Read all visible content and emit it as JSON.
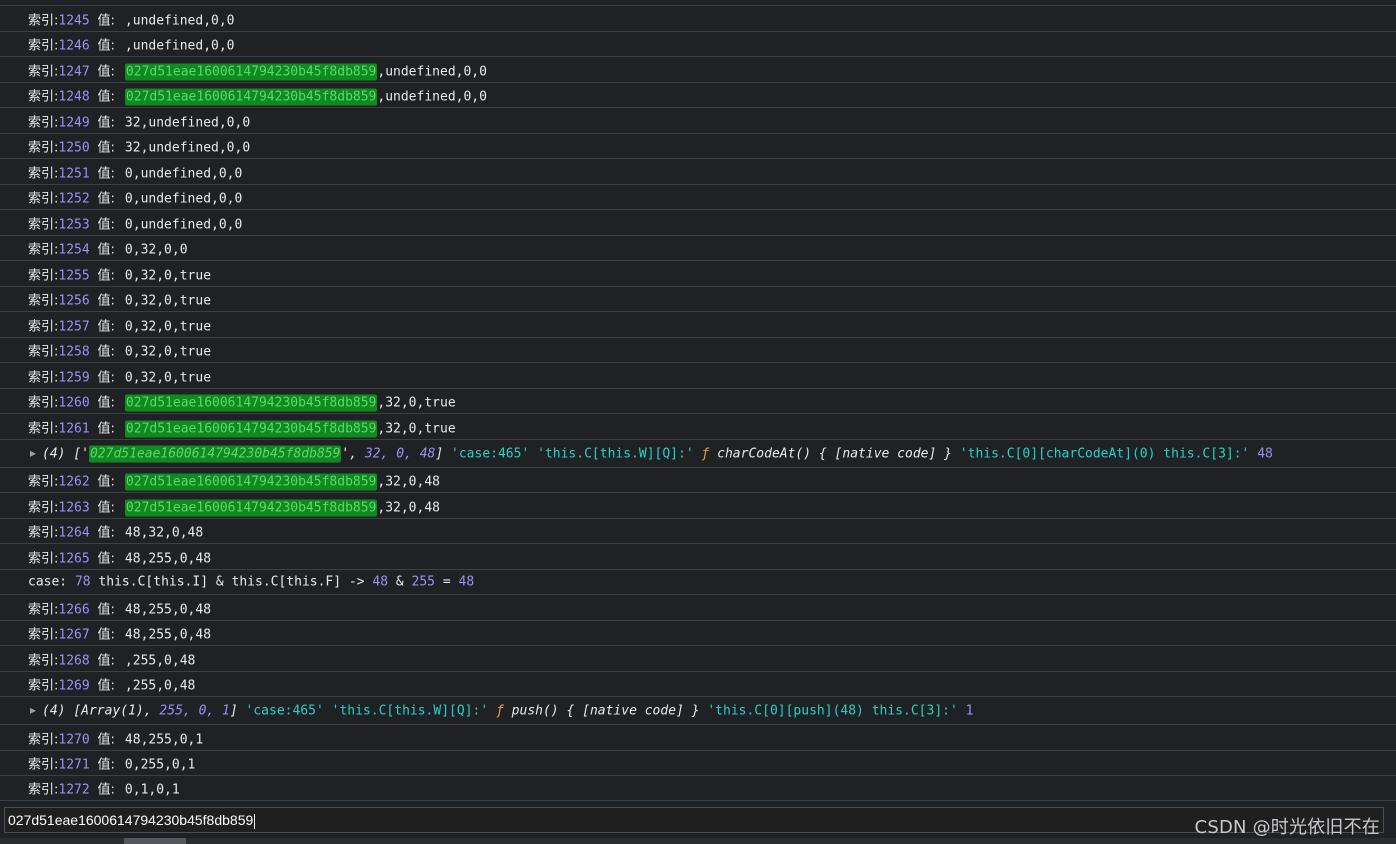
{
  "labels": {
    "index": "索引:",
    "value": "值:",
    "case": "case:"
  },
  "log_rows": [
    {
      "index": "1245",
      "value_pre": ",undefined,0,0",
      "highlight": "",
      "value_post": ""
    },
    {
      "index": "1246",
      "value_pre": ",undefined,0,0",
      "highlight": "",
      "value_post": ""
    },
    {
      "index": "1247",
      "value_pre": "",
      "highlight": "027d51eae1600614794230b45f8db859",
      "value_post": ",undefined,0,0"
    },
    {
      "index": "1248",
      "value_pre": "",
      "highlight": "027d51eae1600614794230b45f8db859",
      "value_post": ",undefined,0,0"
    },
    {
      "index": "1249",
      "value_pre": "32,undefined,0,0",
      "highlight": "",
      "value_post": ""
    },
    {
      "index": "1250",
      "value_pre": "32,undefined,0,0",
      "highlight": "",
      "value_post": ""
    },
    {
      "index": "1251",
      "value_pre": "0,undefined,0,0",
      "highlight": "",
      "value_post": ""
    },
    {
      "index": "1252",
      "value_pre": "0,undefined,0,0",
      "highlight": "",
      "value_post": ""
    },
    {
      "index": "1253",
      "value_pre": "0,undefined,0,0",
      "highlight": "",
      "value_post": ""
    },
    {
      "index": "1254",
      "value_pre": "0,32,0,0",
      "highlight": "",
      "value_post": ""
    },
    {
      "index": "1255",
      "value_pre": "0,32,0,true",
      "highlight": "",
      "value_post": ""
    },
    {
      "index": "1256",
      "value_pre": "0,32,0,true",
      "highlight": "",
      "value_post": ""
    },
    {
      "index": "1257",
      "value_pre": "0,32,0,true",
      "highlight": "",
      "value_post": ""
    },
    {
      "index": "1258",
      "value_pre": "0,32,0,true",
      "highlight": "",
      "value_post": ""
    },
    {
      "index": "1259",
      "value_pre": "0,32,0,true",
      "highlight": "",
      "value_post": ""
    },
    {
      "index": "1260",
      "value_pre": "",
      "highlight": "027d51eae1600614794230b45f8db859",
      "value_post": ",32,0,true"
    },
    {
      "index": "1261",
      "value_pre": "",
      "highlight": "027d51eae1600614794230b45f8db859",
      "value_post": ",32,0,true"
    },
    {
      "index": "1262",
      "value_pre": "",
      "highlight": "027d51eae1600614794230b45f8db859",
      "value_post": ",32,0,48"
    },
    {
      "index": "1263",
      "value_pre": "",
      "highlight": "027d51eae1600614794230b45f8db859",
      "value_post": ",32,0,48"
    },
    {
      "index": "1264",
      "value_pre": "48,32,0,48",
      "highlight": "",
      "value_post": ""
    },
    {
      "index": "1265",
      "value_pre": "48,255,0,48",
      "highlight": "",
      "value_post": ""
    },
    {
      "index": "1266",
      "value_pre": "48,255,0,48",
      "highlight": "",
      "value_post": ""
    },
    {
      "index": "1267",
      "value_pre": "48,255,0,48",
      "highlight": "",
      "value_post": ""
    },
    {
      "index": "1268",
      "value_pre": ",255,0,48",
      "highlight": "",
      "value_post": ""
    },
    {
      "index": "1269",
      "value_pre": ",255,0,48",
      "highlight": "",
      "value_post": ""
    },
    {
      "index": "1270",
      "value_pre": "48,255,0,1",
      "highlight": "",
      "value_post": ""
    },
    {
      "index": "1271",
      "value_pre": "0,255,0,1",
      "highlight": "",
      "value_post": ""
    },
    {
      "index": "1272",
      "value_pre": "0,1,0,1",
      "highlight": "",
      "value_post": ""
    }
  ],
  "array_log_1": {
    "count": "(4)",
    "open": "['",
    "highlight": "027d51eae1600614794230b45f8db859",
    "close_quote": "',",
    "n1": "32,",
    "n2": "0,",
    "n3": "48",
    "close": "]",
    "s1": "'case:465'",
    "s2": "'this.C[this.W][Q]:'",
    "f": "ƒ",
    "fn_text": "charCodeAt() { [native code] }",
    "s3": "'this.C[0][charCodeAt](0) this.C[3]:'",
    "tail": "48"
  },
  "case_log": {
    "num": "78",
    "expr": "this.C[this.I] & this.C[this.F] ->",
    "a": "48",
    "op": "&",
    "b": "255",
    "eq": "=",
    "result": "48"
  },
  "array_log_2": {
    "count": "(4)",
    "open": "[Array(1),",
    "n1": "255,",
    "n2": "0,",
    "n3": "1",
    "close": "]",
    "s1": "'case:465'",
    "s2": "'this.C[this.W][Q]:'",
    "f": "ƒ",
    "fn_text": "push() { [native code] }",
    "s3": "'this.C[0][push](48) this.C[3]:'",
    "tail": "1"
  },
  "console_input": {
    "value": "027d51eae1600614794230b45f8db859"
  },
  "watermark": "CSDN @时光依旧不在",
  "colors": {
    "background": "#202124",
    "index_purple": "#9e8ff5",
    "highlight_green": "#0f8a1f",
    "string_cyan": "#22d3c5"
  }
}
